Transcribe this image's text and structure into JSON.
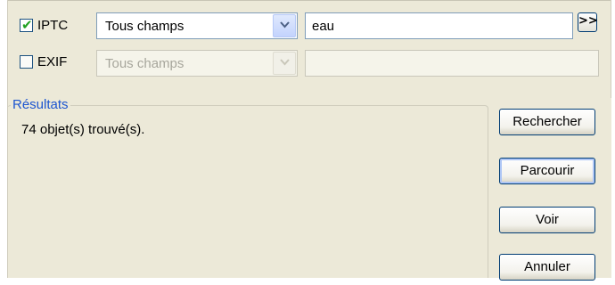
{
  "filters": [
    {
      "label": "IPTC",
      "checked": true,
      "field": "Tous champs",
      "value": "",
      "enabled": true
    },
    {
      "label": "EXIF",
      "checked": false,
      "field": "Tous champs",
      "value": "",
      "enabled": false
    }
  ],
  "search": {
    "value": "eau",
    "more_label": ">>"
  },
  "results": {
    "title": "Résultats",
    "count_text": "74 objet(s) trouvé(s)."
  },
  "buttons": {
    "search": "Rechercher",
    "browse": "Parcourir",
    "view": "Voir",
    "cancel": "Annuler"
  },
  "icons": {
    "check": "check-icon",
    "dropdown": "chevron-down-icon"
  },
  "colors": {
    "panel_bg": "#ece9d8",
    "group_title": "#1c55d0",
    "checkmark": "#21a121",
    "input_border": "#7f9db9"
  }
}
